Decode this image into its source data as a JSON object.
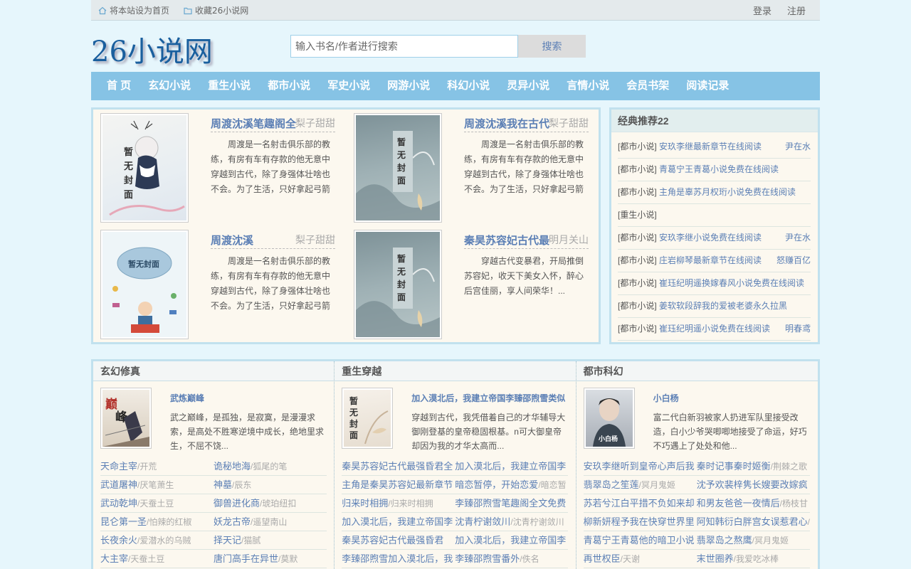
{
  "topbar": {
    "set_home": "将本站设为首页",
    "bookmark": "收藏26小说网",
    "login": "登录",
    "register": "注册"
  },
  "header": {
    "logo": "26小说网",
    "search_placeholder": "输入书名/作者进行搜索",
    "search_button": "搜索"
  },
  "nav": [
    "首 页",
    "玄幻小说",
    "重生小说",
    "都市小说",
    "军史小说",
    "网游小说",
    "科幻小说",
    "灵异小说",
    "言情小说",
    "会员书架",
    "阅读记录"
  ],
  "featured": [
    {
      "title": "周渡沈溪笔趣阁全",
      "author": "梨子甜甜",
      "desc": "周渡是一名射击俱乐部的教练，有房有车有存款的他无意中穿越到古代，除了身强体壮啥也不会。为了生活，只好拿起弓箭做一"
    },
    {
      "title": "周渡沈溪我在古代",
      "author": "梨子甜甜",
      "desc": "周渡是一名射击俱乐部的教练，有房有车有存款的他无意中穿越到古代，除了身强体壮啥也不会。为了生活，只好拿起弓箭做一"
    },
    {
      "title": "周渡沈溪",
      "author": "梨子甜甜",
      "desc": "周渡是一名射击俱乐部的教练，有房有车有存款的他无意中穿越到古代，除了身强体壮啥也不会。为了生活，只好拿起弓箭做一"
    },
    {
      "title": "秦昊苏容妃古代最",
      "author": "明月关山",
      "desc": "穿越古代变暴君，开局推倒苏容妃，收天下美女入怀，醉心后宫佳丽，享人间荣华！..."
    }
  ],
  "recommend": {
    "title": "经典推荐22",
    "items": [
      {
        "cat": "[都市小说]",
        "name": "安玖李继最新章节在线阅读",
        "author": "尹在水"
      },
      {
        "cat": "[都市小说]",
        "name": "青葛宁王青葛小说免费在线阅读",
        "author": ""
      },
      {
        "cat": "[都市小说]",
        "name": "主角是辜苏月权珩小说免费在线阅读",
        "author": ""
      },
      {
        "cat": "[重生小说]",
        "name": "",
        "author": ""
      },
      {
        "cat": "[都市小说]",
        "name": "安玖李继小说免费在线阅读",
        "author": "尹在水"
      },
      {
        "cat": "[都市小说]",
        "name": "庄岩柳琴最新章节在线阅读",
        "author": "怒赚百亿"
      },
      {
        "cat": "[都市小说]",
        "name": "崔珏纪明遥换嫁春风小说免费在线阅读",
        "author": ""
      },
      {
        "cat": "[都市小说]",
        "name": "姜软软段辞我的爱被老婆永久拉黑",
        "author": ""
      },
      {
        "cat": "[都市小说]",
        "name": "崔珏纪明遥小说免费在线阅读",
        "author": "明春鸢"
      }
    ]
  },
  "columns": [
    {
      "title": "玄幻修真",
      "top": {
        "title": "武炼巅峰",
        "desc": "武之巅峰，是孤独，是寂寞，是漫漫求索，是高处不胜寒逆境中成长，绝地里求生，不屈不饶..."
      },
      "list": [
        {
          "name": "天命主宰",
          "author": "/开荒"
        },
        {
          "name": "诡秘地海",
          "author": "/狐尾的笔"
        },
        {
          "name": "武道屠神",
          "author": "/厌笔萧生"
        },
        {
          "name": "神墓",
          "author": "/辰东"
        },
        {
          "name": "武动乾坤",
          "author": "/天蚕土豆"
        },
        {
          "name": "御兽进化商",
          "author": "/琥珀纽扣"
        },
        {
          "name": "昆仑第一圣",
          "author": "/怕辣的红椒"
        },
        {
          "name": "妖龙古帝",
          "author": "/遥望南山"
        },
        {
          "name": "长夜余火",
          "author": "/爱潜水的乌贼"
        },
        {
          "name": "择天记",
          "author": "/猫腻"
        },
        {
          "name": "大主宰",
          "author": "/天蚕土豆"
        },
        {
          "name": "唐门高手在异世",
          "author": "/莫默"
        }
      ]
    },
    {
      "title": "重生穿越",
      "top": {
        "title": "加入漠北后，我建立帝国李臻邵煦雪类似",
        "desc": "穿越到古代，我凭借着自己的才华辅导大御刚登基的皇帝稳固根基。n可大御皇帝却因为我的才华太高而..."
      },
      "list": [
        {
          "name": "秦昊苏容妃古代最强昏君全",
          "author": ""
        },
        {
          "name": "加入漠北后，我建立帝国李",
          "author": ""
        },
        {
          "name": "主角是秦昊苏容妃最新章节",
          "author": ""
        },
        {
          "name": "暗恋暂停，开始恋爱",
          "author": "/暗恋暂"
        },
        {
          "name": "归来时相拥",
          "author": "/归来时相拥"
        },
        {
          "name": "李臻邵煦雪笔趣阁全文免费",
          "author": ""
        },
        {
          "name": "加入漠北后，我建立帝国李",
          "author": ""
        },
        {
          "name": "沈青柠谢敛川",
          "author": "/沈青柠谢敛川"
        },
        {
          "name": "秦昊苏容妃古代最强昏君",
          "author": ""
        },
        {
          "name": "加入漠北后，我建立帝国李",
          "author": ""
        },
        {
          "name": "李臻邵煦雪加入漠北后，我",
          "author": ""
        },
        {
          "name": "李臻邵煦雪番外",
          "author": "/佚名"
        }
      ]
    },
    {
      "title": "都市科幻",
      "top": {
        "title": "小白杨",
        "desc": "富二代白新羽被家人扔进军队里接受改造，白小少爷哭唧唧地接受了命运，好巧不巧遇上了处处和他..."
      },
      "list": [
        {
          "name": "安玖李继听到皇帝心声后我",
          "author": ""
        },
        {
          "name": "秦时记事秦时姬衡",
          "author": "/荆棘之歌"
        },
        {
          "name": "翡翠岛之笙莲",
          "author": "/冥月鬼姬"
        },
        {
          "name": "沈予欢裴梓隽长嫂要改嫁疯",
          "author": ""
        },
        {
          "name": "苏若兮江白平措不负如来却",
          "author": ""
        },
        {
          "name": "和男友爸爸一夜情后",
          "author": "/杨枝甘"
        },
        {
          "name": "柳新妍程予我在快穿世界里",
          "author": ""
        },
        {
          "name": "阿知韩衍白胖宫女误惹君心",
          "author": "/"
        },
        {
          "name": "青葛宁王青葛他的暗卫小说",
          "author": ""
        },
        {
          "name": "翡翠岛之熬鹰",
          "author": "/冥月鬼姬"
        },
        {
          "name": "再世权臣",
          "author": "/天谢"
        },
        {
          "name": "末世圈养",
          "author": "/我爱吃冰棒"
        }
      ]
    }
  ]
}
